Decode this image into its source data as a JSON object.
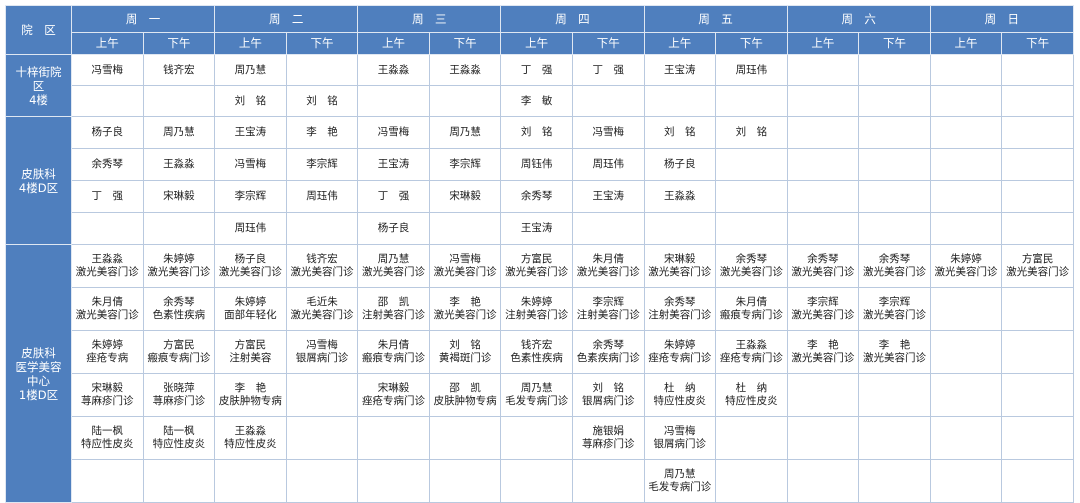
{
  "header": {
    "campus_label": "院　区",
    "days": [
      "周　一",
      "周　二",
      "周　三",
      "周　四",
      "周　五",
      "周　六",
      "周　日"
    ],
    "sessions": [
      "上午",
      "下午",
      "上午",
      "下午",
      "上午",
      "下午",
      "上午",
      "下午",
      "上午",
      "下午",
      "上午",
      "下午",
      "上午",
      "下午"
    ]
  },
  "sections": [
    {
      "name_lines": [
        "十梓街院",
        "区",
        "4楼"
      ],
      "rows": [
        [
          [
            "冯雪梅"
          ],
          [
            "钱齐宏"
          ],
          [
            "周乃慧"
          ],
          [],
          [
            "王淼淼"
          ],
          [
            "王淼淼"
          ],
          [
            "丁　强"
          ],
          [
            "丁　强"
          ],
          [
            "王宝涛"
          ],
          [
            "周珏伟"
          ],
          [],
          [],
          [],
          []
        ],
        [
          [],
          [],
          [
            "刘　铭"
          ],
          [
            "刘　铭"
          ],
          [],
          [],
          [
            "李　敏"
          ],
          [],
          [],
          [],
          [],
          [],
          [],
          []
        ]
      ]
    },
    {
      "name_lines": [
        "皮肤科",
        "4楼D区"
      ],
      "rows": [
        [
          [
            "杨子良"
          ],
          [
            "周乃慧"
          ],
          [
            "王宝涛"
          ],
          [
            "李　艳"
          ],
          [
            "冯雪梅"
          ],
          [
            "周乃慧"
          ],
          [
            "刘　铭"
          ],
          [
            "冯雪梅"
          ],
          [
            "刘　铭"
          ],
          [
            "刘　铭"
          ],
          [],
          [],
          [],
          []
        ],
        [
          [
            "余秀琴"
          ],
          [
            "王淼淼"
          ],
          [
            "冯雪梅"
          ],
          [
            "李宗辉"
          ],
          [
            "王宝涛"
          ],
          [
            "李宗辉"
          ],
          [
            "周钰伟"
          ],
          [
            "周珏伟"
          ],
          [
            "杨子良"
          ],
          [],
          [],
          [],
          [],
          []
        ],
        [
          [
            "丁　强"
          ],
          [
            "宋琳毅"
          ],
          [
            "李宗辉"
          ],
          [
            "周珏伟"
          ],
          [
            "丁　强"
          ],
          [
            "宋琳毅"
          ],
          [
            "余秀琴"
          ],
          [
            "王宝涛"
          ],
          [
            "王淼淼"
          ],
          [],
          [],
          [],
          [],
          []
        ],
        [
          [],
          [],
          [
            "周珏伟"
          ],
          [],
          [
            "杨子良"
          ],
          [],
          [
            "王宝涛"
          ],
          [],
          [],
          [],
          [],
          [],
          [],
          []
        ]
      ]
    },
    {
      "name_lines": [
        "皮肤科",
        "医学美容",
        "中心",
        "1楼D区"
      ],
      "rows": [
        [
          [
            "王淼淼",
            "激光美容门诊"
          ],
          [
            "朱婷婷",
            "激光美容门诊"
          ],
          [
            "杨子良",
            "激光美容门诊"
          ],
          [
            "钱齐宏",
            "激光美容门诊"
          ],
          [
            "周乃慧",
            "激光美容门诊"
          ],
          [
            "冯雪梅",
            "激光美容门诊"
          ],
          [
            "方富民",
            "激光美容门诊"
          ],
          [
            "朱月倩",
            "激光美容门诊"
          ],
          [
            "宋琳毅",
            "激光美容门诊"
          ],
          [
            "余秀琴",
            "激光美容门诊"
          ],
          [
            "余秀琴",
            "激光美容门诊"
          ],
          [
            "余秀琴",
            "激光美容门诊"
          ],
          [
            "朱婷婷",
            "激光美容门诊"
          ],
          [
            "方富民",
            "激光美容门诊"
          ]
        ],
        [
          [
            "朱月倩",
            "激光美容门诊"
          ],
          [
            "余秀琴",
            "色素性疾病"
          ],
          [
            "朱婷婷",
            "面部年轻化"
          ],
          [
            "毛近朱",
            "激光美容门诊"
          ],
          [
            "邵　凯",
            "注射美容门诊"
          ],
          [
            "李　艳",
            "激光美容门诊"
          ],
          [
            "朱婷婷",
            "注射美容门诊"
          ],
          [
            "李宗辉",
            "注射美容门诊"
          ],
          [
            "余秀琴",
            "注射美容门诊"
          ],
          [
            "朱月倩",
            "瘢痕专病门诊"
          ],
          [
            "李宗辉",
            "激光美容门诊"
          ],
          [
            "李宗辉",
            "激光美容门诊"
          ],
          [],
          []
        ],
        [
          [
            "朱婷婷",
            "痤疮专病"
          ],
          [
            "方富民",
            "瘢痕专病门诊"
          ],
          [
            "方富民",
            "注射美容"
          ],
          [
            "冯雪梅",
            "银屑病门诊"
          ],
          [
            "朱月倩",
            "瘢痕专病门诊"
          ],
          [
            "刘　铭",
            "黄褐斑门诊"
          ],
          [
            "钱齐宏",
            "色素性疾病"
          ],
          [
            "余秀琴",
            "色素疾病门诊"
          ],
          [
            "朱婷婷",
            "痤疮专病门诊"
          ],
          [
            "王淼淼",
            "痤疮专病门诊"
          ],
          [
            "李　艳",
            "激光美容门诊"
          ],
          [
            "李　艳",
            "激光美容门诊"
          ],
          [],
          []
        ],
        [
          [
            "宋琳毅",
            "荨麻疹门诊"
          ],
          [
            "张晓萍",
            "荨麻疹门诊"
          ],
          [
            "李　艳",
            "皮肤肿物专病"
          ],
          [],
          [
            "宋琳毅",
            "痤疮专病门诊"
          ],
          [
            "邵　凯",
            "皮肤肿物专病"
          ],
          [
            "周乃慧",
            "毛发专病门诊"
          ],
          [
            "刘　铭",
            "银屑病门诊"
          ],
          [
            "杜　纳",
            "特应性皮炎"
          ],
          [
            "杜　纳",
            "特应性皮炎"
          ],
          [],
          [],
          [],
          []
        ],
        [
          [
            "陆一枫",
            "特应性皮炎"
          ],
          [
            "陆一枫",
            "特应性皮炎"
          ],
          [
            "王淼淼",
            "特应性皮炎"
          ],
          [],
          [],
          [],
          [],
          [
            "施银娟",
            "荨麻疹门诊"
          ],
          [
            "冯雪梅",
            "银屑病门诊"
          ],
          [],
          [],
          [],
          [],
          []
        ],
        [
          [],
          [],
          [],
          [],
          [],
          [],
          [],
          [],
          [
            "周乃慧",
            "毛发专病门诊"
          ],
          [],
          [],
          [],
          [],
          []
        ]
      ]
    }
  ],
  "colors": {
    "header_bg": "#4f7fbe",
    "header_text": "#ffffff",
    "grid": "#b9c9df",
    "cell_text": "#1c1c1c"
  }
}
